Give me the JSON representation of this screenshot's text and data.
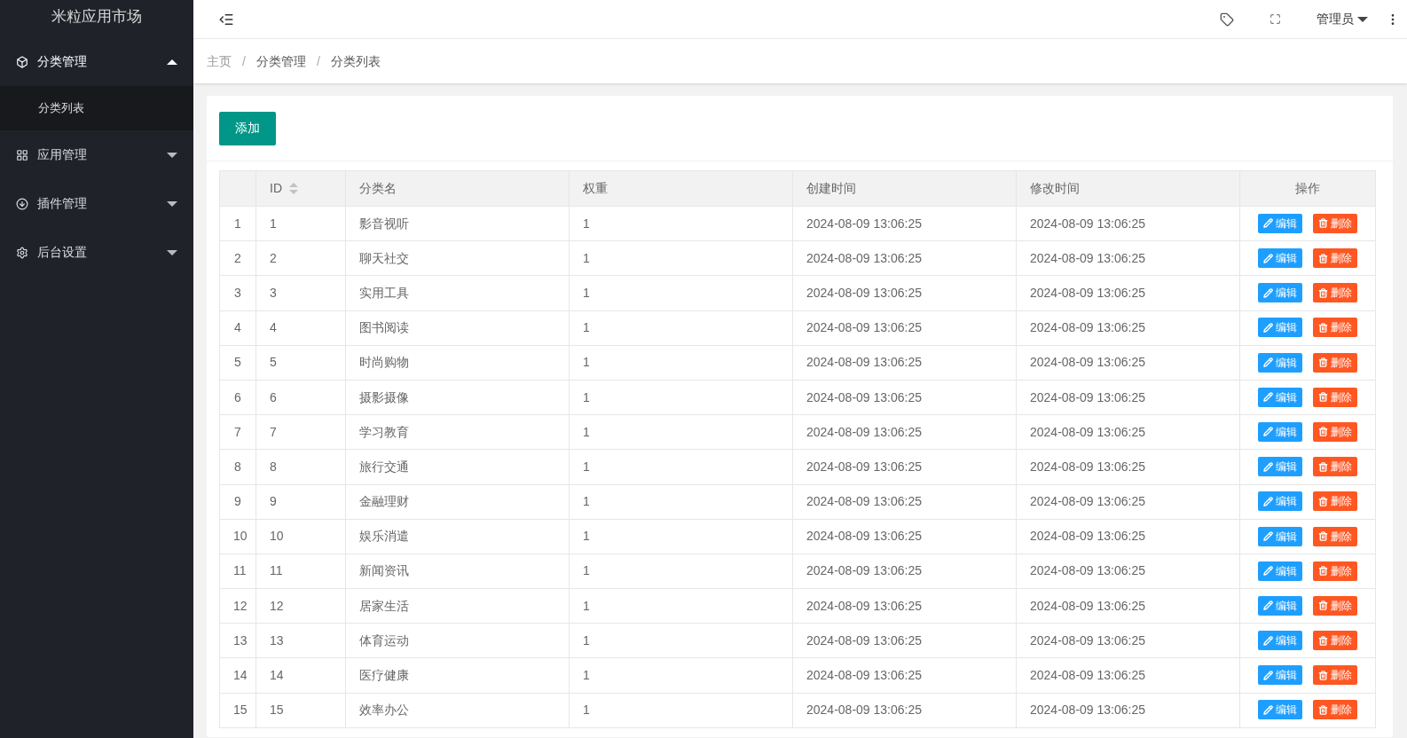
{
  "sidebar": {
    "logo": "米粒应用市场",
    "items": [
      {
        "label": "分类管理",
        "expanded": true,
        "children": [
          {
            "label": "分类列表",
            "selected": true
          }
        ]
      },
      {
        "label": "应用管理",
        "expanded": false
      },
      {
        "label": "插件管理",
        "expanded": false
      },
      {
        "label": "后台设置",
        "expanded": false
      }
    ]
  },
  "header": {
    "user": "管理员"
  },
  "breadcrumb": [
    {
      "kind": "link",
      "text": "主页"
    },
    {
      "kind": "separator",
      "text": "/"
    },
    {
      "kind": "link",
      "text": "分类管理"
    },
    {
      "kind": "separator",
      "text": "/"
    },
    {
      "kind": "current",
      "text": "分类列表"
    }
  ],
  "add_button": "添加",
  "table": {
    "columns": [
      "",
      "ID",
      "分类名",
      "权重",
      "创建时间",
      "修改时间",
      "操作"
    ],
    "rows": [
      {
        "cells": [
          "1",
          "1",
          "影音视听",
          "1",
          "2024-08-09 13:06:25",
          "2024-08-09 13:06:25"
        ],
        "edit": "编辑",
        "delete": "删除"
      },
      {
        "cells": [
          "2",
          "2",
          "聊天社交",
          "1",
          "2024-08-09 13:06:25",
          "2024-08-09 13:06:25"
        ],
        "edit": "编辑",
        "delete": "删除"
      },
      {
        "cells": [
          "3",
          "3",
          "实用工具",
          "1",
          "2024-08-09 13:06:25",
          "2024-08-09 13:06:25"
        ],
        "edit": "编辑",
        "delete": "删除"
      },
      {
        "cells": [
          "4",
          "4",
          "图书阅读",
          "1",
          "2024-08-09 13:06:25",
          "2024-08-09 13:06:25"
        ],
        "edit": "编辑",
        "delete": "删除"
      },
      {
        "cells": [
          "5",
          "5",
          "时尚购物",
          "1",
          "2024-08-09 13:06:25",
          "2024-08-09 13:06:25"
        ],
        "edit": "编辑",
        "delete": "删除"
      },
      {
        "cells": [
          "6",
          "6",
          "摄影摄像",
          "1",
          "2024-08-09 13:06:25",
          "2024-08-09 13:06:25"
        ],
        "edit": "编辑",
        "delete": "删除"
      },
      {
        "cells": [
          "7",
          "7",
          "学习教育",
          "1",
          "2024-08-09 13:06:25",
          "2024-08-09 13:06:25"
        ],
        "edit": "编辑",
        "delete": "删除"
      },
      {
        "cells": [
          "8",
          "8",
          "旅行交通",
          "1",
          "2024-08-09 13:06:25",
          "2024-08-09 13:06:25"
        ],
        "edit": "编辑",
        "delete": "删除"
      },
      {
        "cells": [
          "9",
          "9",
          "金融理财",
          "1",
          "2024-08-09 13:06:25",
          "2024-08-09 13:06:25"
        ],
        "edit": "编辑",
        "delete": "删除"
      },
      {
        "cells": [
          "10",
          "10",
          "娱乐消遣",
          "1",
          "2024-08-09 13:06:25",
          "2024-08-09 13:06:25"
        ],
        "edit": "编辑",
        "delete": "删除"
      },
      {
        "cells": [
          "11",
          "11",
          "新闻资讯",
          "1",
          "2024-08-09 13:06:25",
          "2024-08-09 13:06:25"
        ],
        "edit": "编辑",
        "delete": "删除"
      },
      {
        "cells": [
          "12",
          "12",
          "居家生活",
          "1",
          "2024-08-09 13:06:25",
          "2024-08-09 13:06:25"
        ],
        "edit": "编辑",
        "delete": "删除"
      },
      {
        "cells": [
          "13",
          "13",
          "体育运动",
          "1",
          "2024-08-09 13:06:25",
          "2024-08-09 13:06:25"
        ],
        "edit": "编辑",
        "delete": "删除"
      },
      {
        "cells": [
          "14",
          "14",
          "医疗健康",
          "1",
          "2024-08-09 13:06:25",
          "2024-08-09 13:06:25"
        ],
        "edit": "编辑",
        "delete": "删除"
      },
      {
        "cells": [
          "15",
          "15",
          "效率办公",
          "1",
          "2024-08-09 13:06:25",
          "2024-08-09 13:06:25"
        ],
        "edit": "编辑",
        "delete": "删除"
      }
    ]
  }
}
